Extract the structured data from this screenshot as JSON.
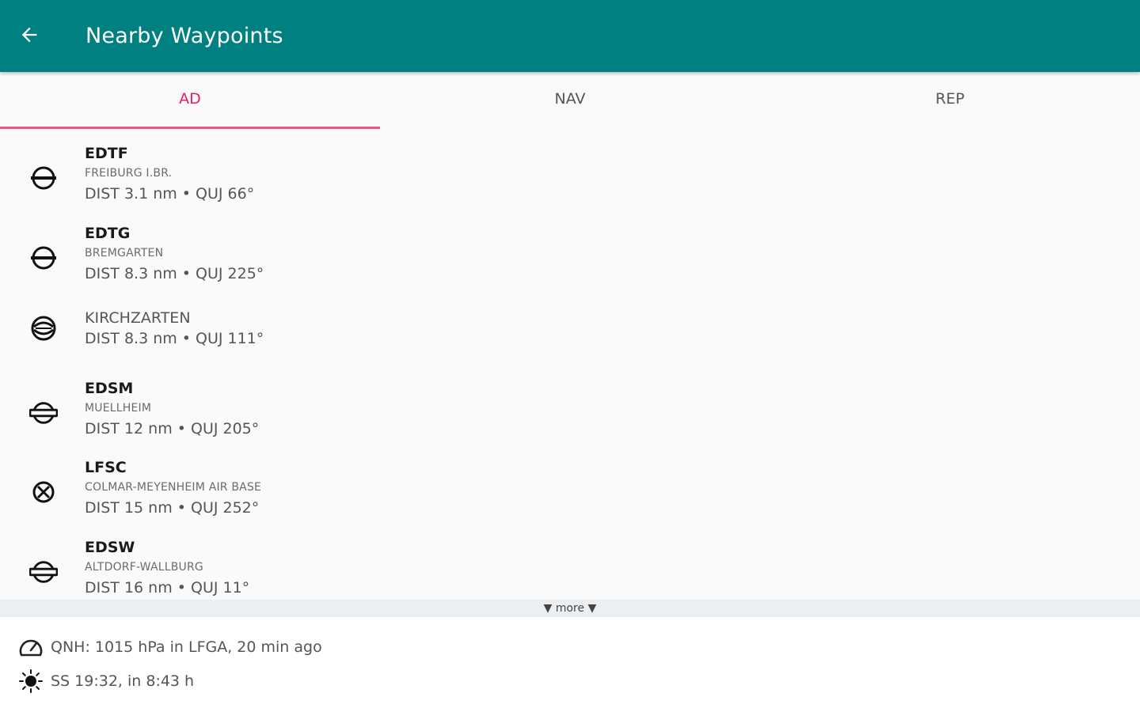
{
  "appbar": {
    "title": "Nearby Waypoints",
    "background": "#008080",
    "back_icon": "arrow-left-icon"
  },
  "tabs": [
    {
      "label": "AD",
      "active": true
    },
    {
      "label": "NAV",
      "active": false
    },
    {
      "label": "REP",
      "active": false
    }
  ],
  "accent_color": "#e91e63",
  "waypoints": [
    {
      "ident": "EDTF",
      "name": "FREIBURG I.BR.",
      "dist": "DIST 3.1 nm • QUJ 66°",
      "icon": "airfield-icon"
    },
    {
      "ident": "EDTG",
      "name": "BREMGARTEN",
      "dist": "DIST 8.3 nm • QUJ 225°",
      "icon": "airfield-icon"
    },
    {
      "ident": "",
      "name": "KIRCHZARTEN",
      "dist": "DIST 8.3 nm • QUJ 111°",
      "icon": "glider-site-icon"
    },
    {
      "ident": "EDSM",
      "name": "MUELLHEIM",
      "dist": "DIST 12 nm • QUJ 205°",
      "icon": "airfield-icon"
    },
    {
      "ident": "LFSC",
      "name": "COLMAR-MEYENHEIM AIR BASE",
      "dist": "DIST 15 nm • QUJ 252°",
      "icon": "military-airfield-icon"
    },
    {
      "ident": "EDSW",
      "name": "ALTDORF-WALLBURG",
      "dist": "DIST 16 nm • QUJ 11°",
      "icon": "airfield-icon"
    }
  ],
  "more": {
    "label": "▼ more ▼"
  },
  "footer": {
    "qnh": "QNH: 1015 hPa in LFGA, 20 min ago",
    "sunset": "SS 19:32, in 8:43 h"
  }
}
